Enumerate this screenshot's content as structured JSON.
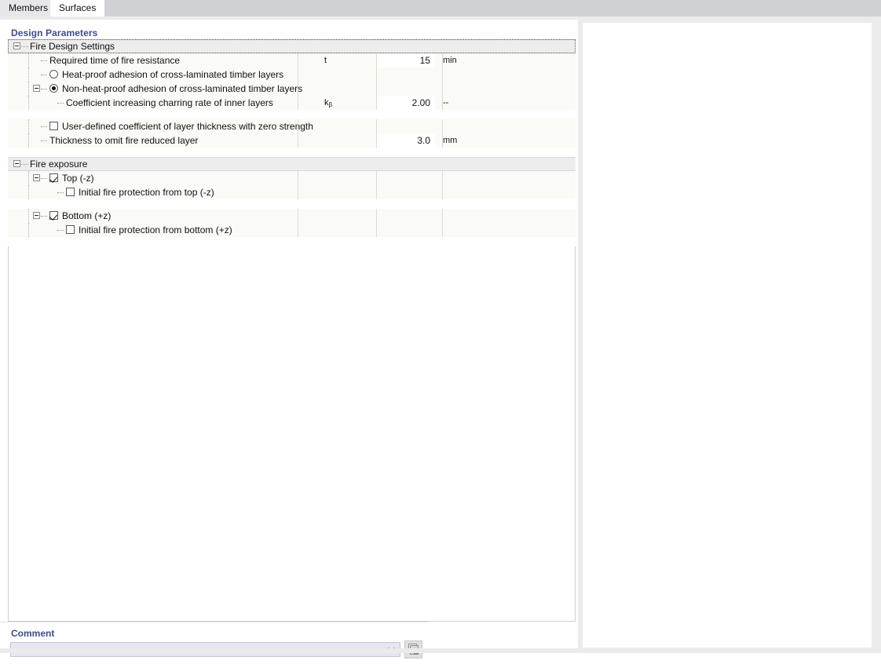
{
  "tabs": [
    {
      "label": "Members",
      "active": false
    },
    {
      "label": "Surfaces",
      "active": true
    }
  ],
  "panel": {
    "section_title": "Design Parameters"
  },
  "tree": {
    "groups": [
      {
        "name": "fire-design-settings",
        "label": "Fire Design Settings",
        "focused": true,
        "rows": [
          {
            "label": "Required time of fire resistance",
            "control": "none",
            "symbol": "t",
            "symbol_sub": "",
            "value": "15",
            "unit": "min",
            "editable": true,
            "indent": 53
          },
          {
            "label": "Heat-proof adhesion of cross-laminated timber layers",
            "control": "radio",
            "checked": false,
            "symbol": "",
            "symbol_sub": "",
            "value": "",
            "unit": "",
            "editable": false,
            "indent": 53
          },
          {
            "label": "Non-heat-proof adhesion of cross-laminated timber layers",
            "control": "radio",
            "checked": true,
            "symbol": "",
            "symbol_sub": "",
            "value": "",
            "unit": "",
            "editable": false,
            "indent": 53,
            "expander": true
          },
          {
            "label": "Coefficient increasing charring rate of inner layers",
            "control": "none",
            "symbol": "k",
            "symbol_sub": "β",
            "value": "2.00",
            "unit": "--",
            "editable": true,
            "indent": 74
          }
        ]
      },
      {
        "name": "zero-strength-layer",
        "label": "",
        "focused": false,
        "rows": [
          {
            "label": "User-defined coefficient of layer thickness with zero strength",
            "control": "checkbox",
            "checked": false,
            "symbol": "",
            "symbol_sub": "",
            "value": "",
            "unit": "",
            "editable": false,
            "indent": 53
          },
          {
            "label": "Thickness to omit fire reduced layer",
            "control": "none",
            "symbol": "",
            "symbol_sub": "",
            "value": "3.0",
            "unit": "mm",
            "editable": true,
            "indent": 53
          }
        ]
      },
      {
        "name": "fire-exposure",
        "label": "Fire exposure",
        "focused": false,
        "rows": [
          {
            "label": "Top (-z)",
            "control": "checkbox",
            "checked": true,
            "symbol": "",
            "symbol_sub": "",
            "value": "",
            "unit": "",
            "editable": false,
            "indent": 53,
            "expander": true
          },
          {
            "label": "Initial fire protection from top (-z)",
            "control": "checkbox",
            "checked": false,
            "symbol": "",
            "symbol_sub": "",
            "value": "",
            "unit": "",
            "editable": false,
            "indent": 74
          }
        ]
      },
      {
        "name": "fire-exposure-bottom",
        "label": "",
        "focused": false,
        "rows": [
          {
            "label": "Bottom (+z)",
            "control": "checkbox",
            "checked": true,
            "symbol": "",
            "symbol_sub": "",
            "value": "",
            "unit": "",
            "editable": false,
            "indent": 53,
            "expander": true
          },
          {
            "label": "Initial fire protection from bottom (+z)",
            "control": "checkbox",
            "checked": false,
            "symbol": "",
            "symbol_sub": "",
            "value": "",
            "unit": "",
            "editable": false,
            "indent": 74
          }
        ]
      }
    ]
  },
  "comment": {
    "label": "Comment",
    "value": "",
    "placeholder": "",
    "copy_icon": "copy-icon",
    "chevron_icon": "chevron-down-icon"
  }
}
